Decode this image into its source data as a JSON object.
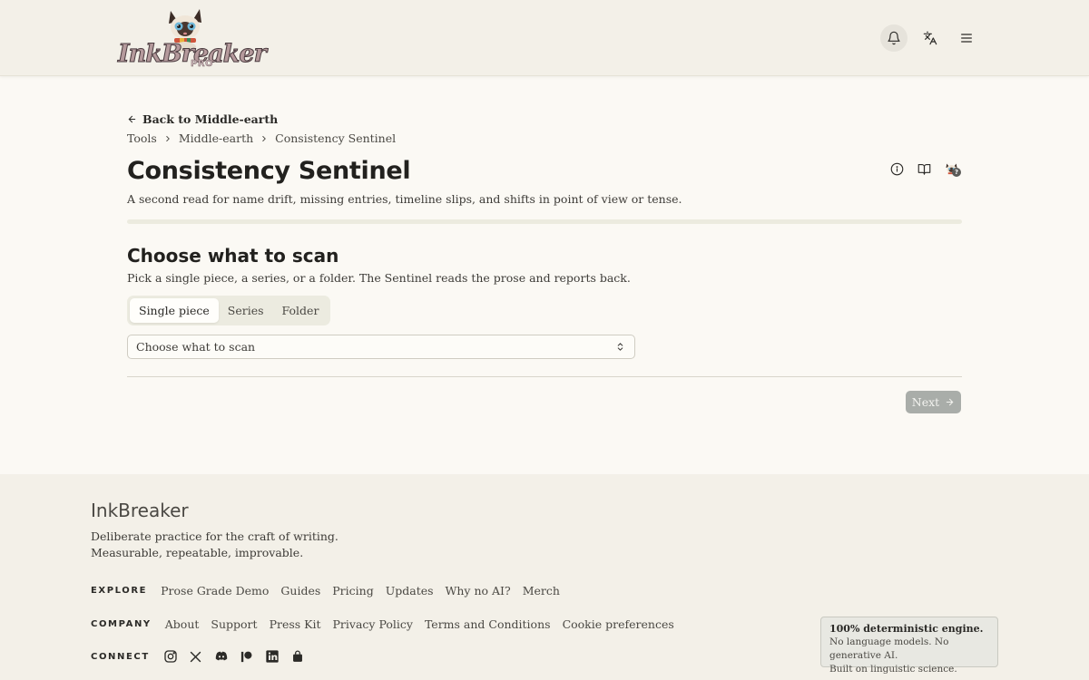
{
  "header": {
    "logo_text": "InkBreaker",
    "logo_badge": "PRO",
    "icons": [
      "bell-icon",
      "translate-icon",
      "menu-icon"
    ]
  },
  "nav": {
    "back_label": "Back to Middle-earth",
    "breadcrumb": [
      "Tools",
      "Middle-earth",
      "Consistency Sentinel"
    ]
  },
  "page": {
    "title": "Consistency Sentinel",
    "subtitle": "A second read for name drift, missing entries, timeline slips, and shifts in point of view or tense.",
    "title_icons": [
      "info-icon",
      "book-icon",
      "mascot-help-icon"
    ],
    "help_badge": "?"
  },
  "scan": {
    "title": "Choose what to scan",
    "description": "Pick a single piece, a series, or a folder. The Sentinel reads the prose and reports back.",
    "tabs": [
      "Single piece",
      "Series",
      "Folder"
    ],
    "active_tab": "Single piece",
    "select_value": "Choose what to scan",
    "next_label": "Next"
  },
  "footer": {
    "brand": "InkBreaker",
    "tagline_1": "Deliberate practice for the craft of writing.",
    "tagline_2": "Measurable, repeatable, improvable.",
    "explore_label": "EXPLORE",
    "explore_links": [
      "Prose Grade Demo",
      "Guides",
      "Pricing",
      "Updates",
      "Why no AI?",
      "Merch"
    ],
    "company_label": "COMPANY",
    "company_links": [
      "About",
      "Support",
      "Press Kit",
      "Privacy Policy",
      "Terms and Conditions",
      "Cookie preferences"
    ],
    "connect_label": "CONNECT",
    "social_icons": [
      "instagram-icon",
      "x-icon",
      "discord-icon",
      "patreon-icon",
      "linkedin-icon",
      "shop-bag-icon"
    ],
    "engine_title": "100% deterministic engine.",
    "engine_line_1": "No language models. No generative AI.",
    "engine_line_2": "Built on linguistic science."
  },
  "colors": {
    "background": "#fbf9f4",
    "header_footer": "#f3f0e8",
    "next_button": "#a9ada9",
    "progress_track": "#ecebdf"
  }
}
